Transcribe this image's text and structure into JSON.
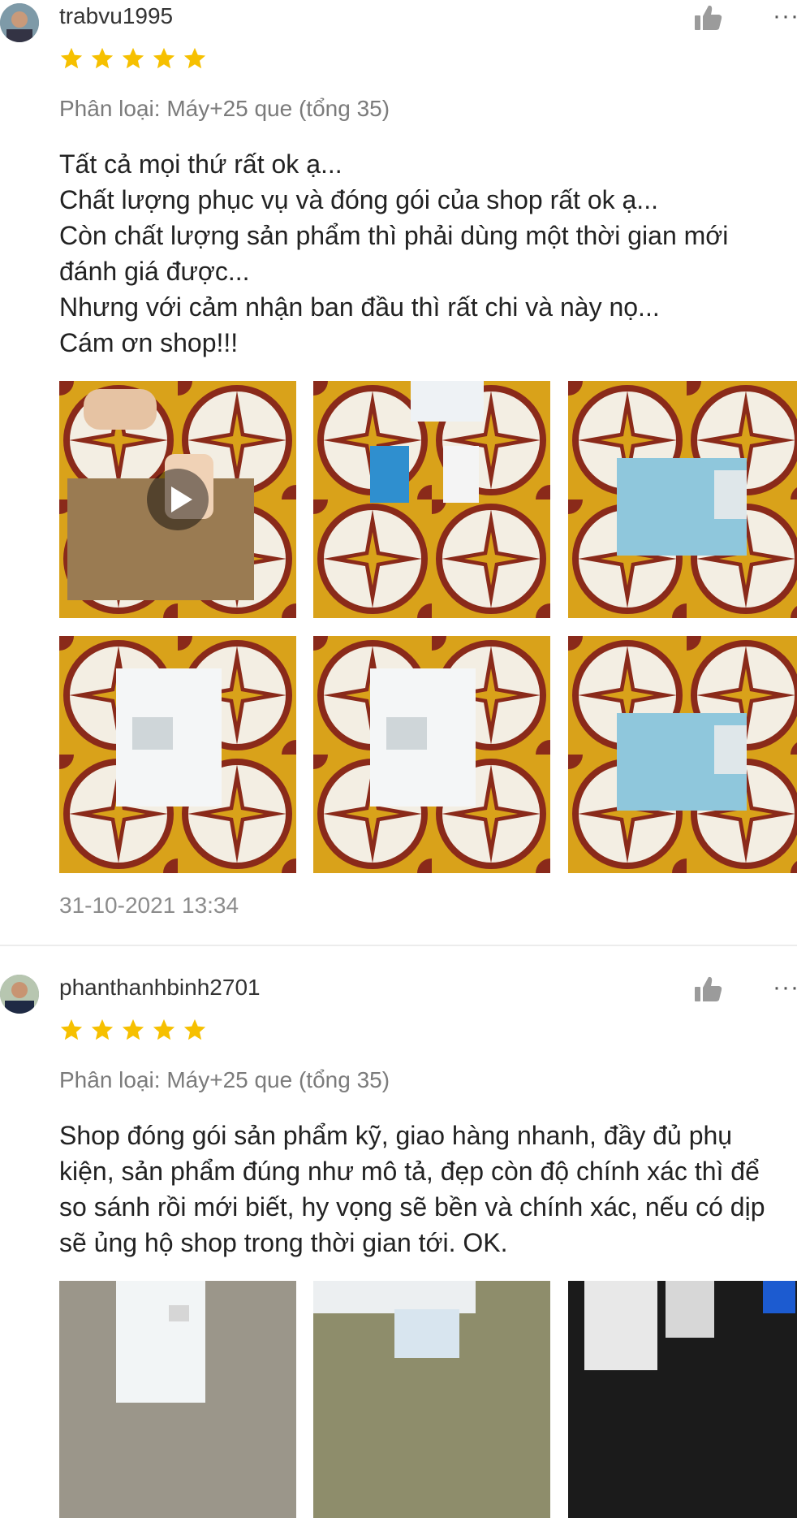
{
  "colors": {
    "star": "#f6c000",
    "muted": "#7b7b7b",
    "divider": "#ececec"
  },
  "reviews": [
    {
      "username": "trabvu1995",
      "rating": 5,
      "variant": "Phân loại: Máy+25 que (tổng 35)",
      "text": "Tất cả mọi thứ rất ok ạ...\nChất lượng phục vụ và đóng gói của shop rất ok ạ...\nCòn chất lượng sản phẩm thì phải dùng một thời gian mới đánh giá được...\nNhưng với cảm nhận ban đầu thì rất chi và này nọ...\nCám ơn shop!!!",
      "timestamp": "31-10-2021 13:34",
      "media_count": 6
    },
    {
      "username": "phanthanhbinh2701",
      "rating": 5,
      "variant": "Phân loại: Máy+25 que (tổng 35)",
      "text": "Shop đóng gói sản phẩm kỹ, giao hàng nhanh, đầy đủ phụ kiện, sản phẩm đúng như mô tả, đẹp còn độ chính xác thì để so sánh rồi mới biết, hy vọng sẽ bền và chính xác, nếu có dịp sẽ ủng hộ shop trong thời gian tới. OK.",
      "media_count": 3
    }
  ],
  "icons": {
    "like": "thumbs-up-icon",
    "more": "more-options-icon",
    "star": "star-icon",
    "play": "play-icon"
  }
}
